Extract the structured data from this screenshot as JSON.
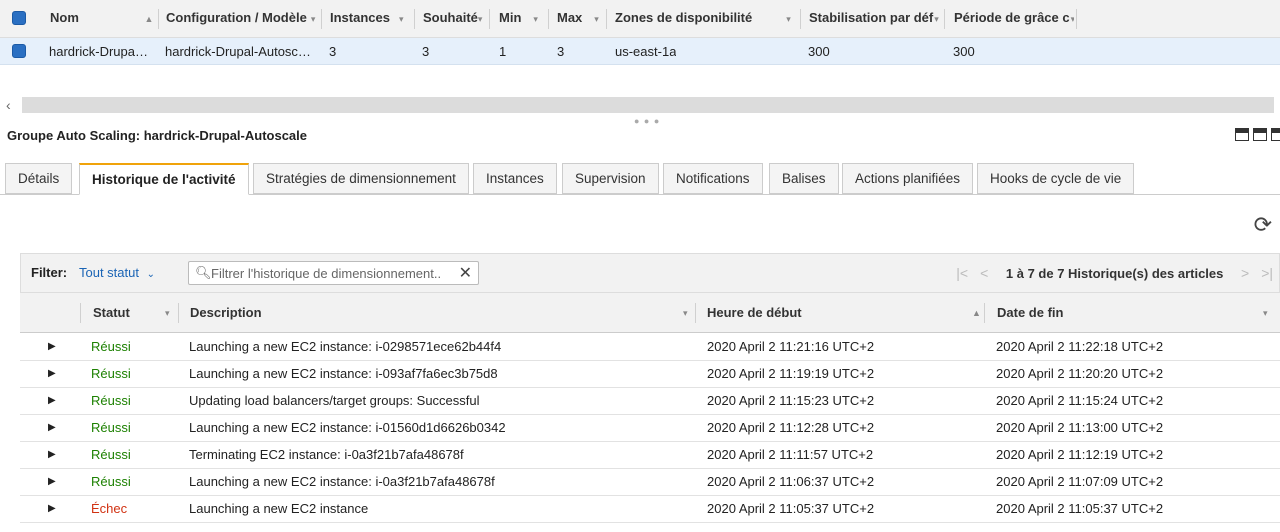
{
  "asg_table": {
    "headers": {
      "name": "Nom",
      "config": "Configuration / Modèle",
      "instances": "Instances",
      "desired": "Souhaité",
      "min": "Min",
      "max": "Max",
      "zones": "Zones de disponibilité",
      "stabilization": "Stabilisation par déf",
      "grace": "Période de grâce c"
    },
    "row": {
      "name": "hardrick-Drupa…",
      "config": "hardrick-Drupal-Autosc…",
      "instances": "3",
      "desired": "3",
      "min": "1",
      "max": "3",
      "zones": "us-east-1a",
      "stabilization": "300",
      "grace": "300"
    }
  },
  "panel": {
    "title": "Groupe Auto Scaling: hardrick-Drupal-Autoscale",
    "tabs": [
      "Détails",
      "Historique de l'activité",
      "Stratégies de dimensionnement",
      "Instances",
      "Supervision",
      "Notifications",
      "Balises",
      "Actions planifiées",
      "Hooks de cycle de vie"
    ],
    "active_tab": "Historique de l'activité"
  },
  "filter": {
    "label": "Filter:",
    "status_value": "Tout statut",
    "search_placeholder": "Filtrer l'historique de dimensionnement..",
    "pagination": "1 à 7 de 7 Historique(s) des articles"
  },
  "activity": {
    "headers": {
      "status": "Statut",
      "description": "Description",
      "start": "Heure de début",
      "end": "Date de fin"
    },
    "rows": [
      {
        "status": "Réussi",
        "description": "Launching a new EC2 instance: i-0298571ece62b44f4",
        "start": "2020 April 2 11:21:16 UTC+2",
        "end": "2020 April 2 11:22:18 UTC+2"
      },
      {
        "status": "Réussi",
        "description": "Launching a new EC2 instance: i-093af7fa6ec3b75d8",
        "start": "2020 April 2 11:19:19 UTC+2",
        "end": "2020 April 2 11:20:20 UTC+2"
      },
      {
        "status": "Réussi",
        "description": "Updating load balancers/target groups: Successful",
        "start": "2020 April 2 11:15:23 UTC+2",
        "end": "2020 April 2 11:15:24 UTC+2"
      },
      {
        "status": "Réussi",
        "description": "Launching a new EC2 instance: i-01560d1d6626b0342",
        "start": "2020 April 2 11:12:28 UTC+2",
        "end": "2020 April 2 11:13:00 UTC+2"
      },
      {
        "status": "Réussi",
        "description": "Terminating EC2 instance: i-0a3f21b7afa48678f",
        "start": "2020 April 2 11:11:57 UTC+2",
        "end": "2020 April 2 11:12:19 UTC+2"
      },
      {
        "status": "Réussi",
        "description": "Launching a new EC2 instance: i-0a3f21b7afa48678f",
        "start": "2020 April 2 11:06:37 UTC+2",
        "end": "2020 April 2 11:07:09 UTC+2"
      },
      {
        "status": "Échec",
        "description": "Launching a new EC2 instance",
        "start": "2020 April 2 11:05:37 UTC+2",
        "end": "2020 April 2 11:05:37 UTC+2"
      }
    ]
  },
  "colors": {
    "success": "#1d8102",
    "failure": "#d13212",
    "link": "#1a64b5",
    "active_tab": "#f0a30a",
    "selected_row": "#e6f0fb"
  },
  "icons": [
    "checkbox-icon",
    "sort-up-icon",
    "dropdown-icon",
    "scroll-left-icon",
    "layout-icon",
    "refresh-icon",
    "search-icon",
    "clear-icon",
    "first-page-icon",
    "prev-page-icon",
    "next-page-icon",
    "last-page-icon",
    "expand-caret-icon"
  ]
}
